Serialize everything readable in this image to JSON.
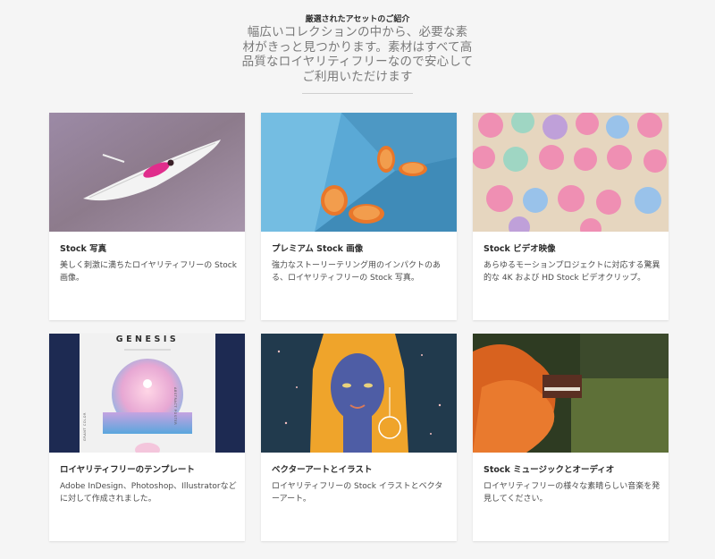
{
  "header": {
    "eyebrow": "厳選されたアセットのご紹介",
    "headline": "幅広いコレクションの中から、必要な素材がきっと見つかります。素材はすべて高品質なロイヤリティフリーなので安心してご利用いただけます"
  },
  "cards": [
    {
      "title": "Stock 写真",
      "desc": "美しく刺激に満ちたロイヤリティフリーの Stock 画像。",
      "image_icon": "boat-photo-icon"
    },
    {
      "title": "プレミアム Stock 画像",
      "desc": "強力なストーリーテリング用のインパクトのある、ロイヤリティフリーの Stock 写真。",
      "image_icon": "oranges-photo-icon"
    },
    {
      "title": "Stock ビデオ映像",
      "desc": "あらゆるモーションプロジェクトに対応する驚異的な 4K および HD Stock ビデオクリップ。",
      "image_icon": "umbrellas-photo-icon"
    },
    {
      "title": "ロイヤリティフリーのテンプレート",
      "desc": "Adobe InDesign、Photoshop、Illustratorなどに対して作成されました。",
      "image_icon": "genesis-poster-icon",
      "poster_title": "GENESIS",
      "poster_side": "ABSTRACT POSTER",
      "poster_side2": "GRANT COLOR"
    },
    {
      "title": "ベクターアートとイラスト",
      "desc": "ロイヤリティフリーの Stock イラストとベクターアート。",
      "image_icon": "portrait-illustration-icon"
    },
    {
      "title": "Stock ミュージックとオーディオ",
      "desc": "ロイヤリティフリーの様々な素晴らしい音楽を発見してください。",
      "image_icon": "piano-smoke-photo-icon"
    }
  ],
  "colors": {
    "background": "#f5f5f5",
    "card": "#ffffff",
    "headline": "#7a7a7a",
    "title": "#2c2c2c"
  }
}
